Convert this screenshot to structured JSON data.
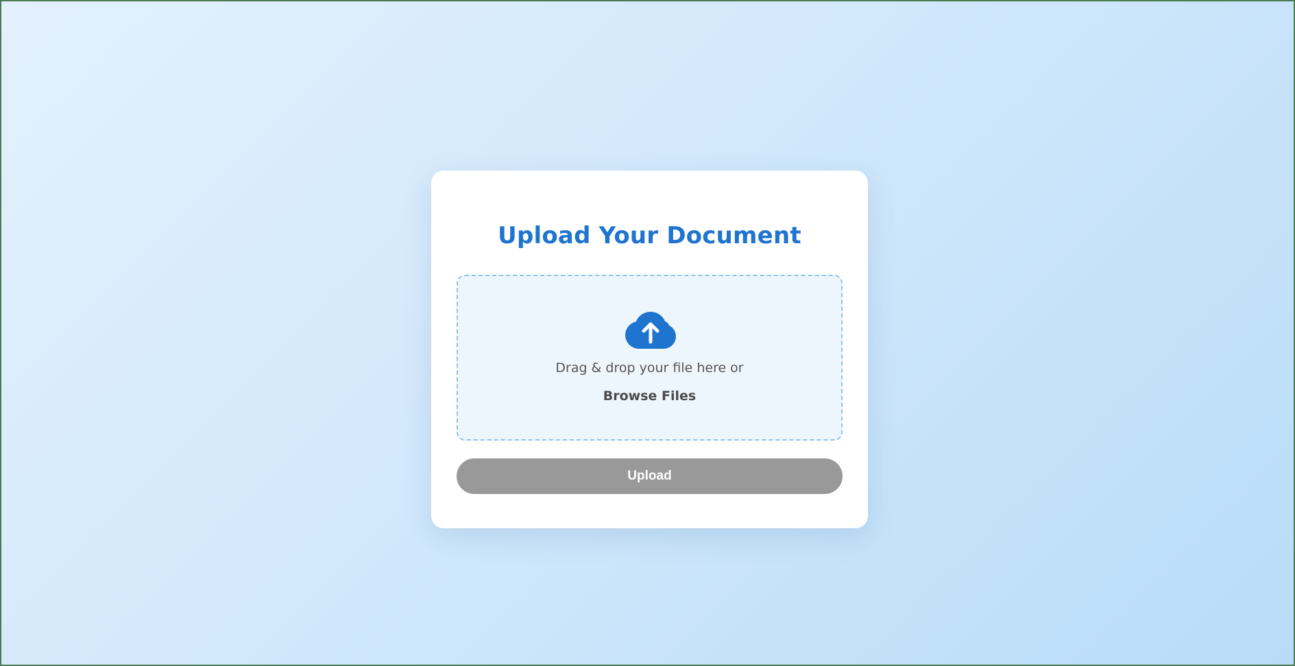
{
  "card": {
    "title": "Upload Your Document"
  },
  "dropzone": {
    "icon": "cloud-upload-icon",
    "instruction": "Drag & drop your file here or",
    "browse_label": "Browse Files"
  },
  "upload_button": {
    "label": "Upload",
    "disabled": true
  },
  "colors": {
    "accent": "#1f74d0",
    "disabled_button": "#999999",
    "dropzone_border": "#8fc3ea",
    "dropzone_bg": "#eef6fd"
  }
}
